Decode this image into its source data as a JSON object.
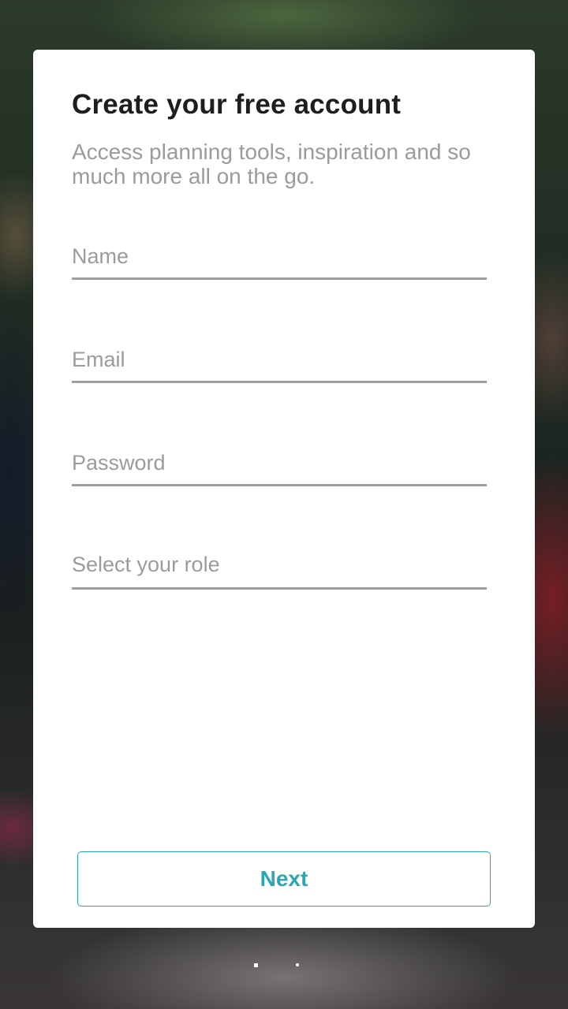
{
  "signup": {
    "title": "Create your free account",
    "subtitle": "Access planning tools, inspiration and so much more all on the go.",
    "name_placeholder": "Name",
    "email_placeholder": "Email",
    "password_placeholder": "Password",
    "role_placeholder": "Select your role",
    "next_label": "Next"
  },
  "pager": {
    "page_count": 2,
    "current_page": 1
  },
  "colors": {
    "accent": "#2aa8b0",
    "title_text": "#1e1e1e",
    "muted_text": "#9b9b9b",
    "underline": "#9e9e9e",
    "card": "#ffffff"
  }
}
